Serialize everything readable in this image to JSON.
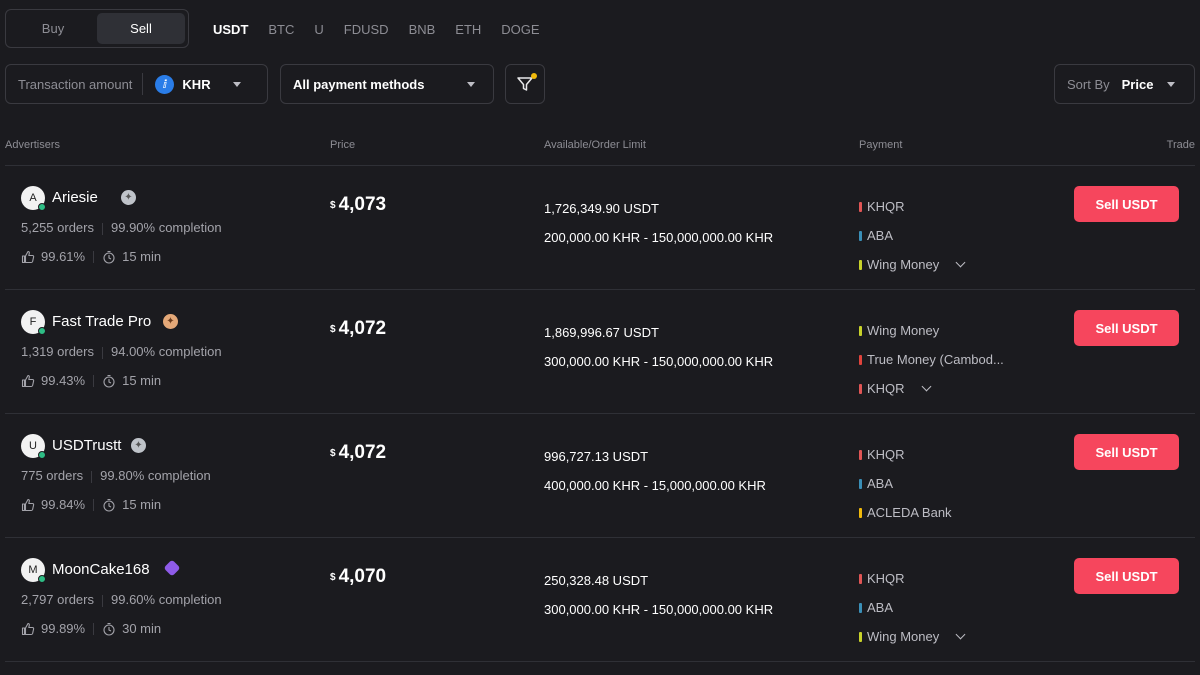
{
  "side_toggle": {
    "buy": "Buy",
    "sell": "Sell",
    "active": "Sell"
  },
  "assets": [
    "USDT",
    "BTC",
    "U",
    "FDUSD",
    "BNB",
    "ETH",
    "DOGE"
  ],
  "active_asset": "USDT",
  "filters": {
    "amount_label": "Transaction amount",
    "fiat": "KHR",
    "payment_methods": "All payment methods",
    "sort_label": "Sort By",
    "sort_value": "Price"
  },
  "columns": {
    "advertisers": "Advertisers",
    "price": "Price",
    "available": "Available/Order Limit",
    "payment": "Payment",
    "trade": "Trade"
  },
  "currency_symbol": "$",
  "colors": {
    "sell_button": "#f6465d",
    "KHQR": "#e05555",
    "ABA": "#3a8fb7",
    "Wing Money": "#c8d22a",
    "True Money (Cambod...": "#e0433c",
    "ACLEDA Bank": "#f0b90b"
  },
  "ads": [
    {
      "initial": "A",
      "name": "Ariesie",
      "badge": "silver",
      "orders": "5,255 orders",
      "completion": "99.90% completion",
      "rating": "99.61%",
      "time": "15 min",
      "price": "4,073",
      "available": "1,726,349.90 USDT",
      "limit": "200,000.00 KHR - 150,000,000.00 KHR",
      "payments": [
        "KHQR",
        "ABA",
        "Wing Money"
      ],
      "more": true,
      "button": "Sell USDT"
    },
    {
      "initial": "F",
      "name": "Fast Trade Pro",
      "badge": "bronze",
      "orders": "1,319 orders",
      "completion": "94.00% completion",
      "rating": "99.43%",
      "time": "15 min",
      "price": "4,072",
      "available": "1,869,996.67 USDT",
      "limit": "300,000.00 KHR - 150,000,000.00 KHR",
      "payments": [
        "Wing Money",
        "True Money (Cambod...",
        "KHQR"
      ],
      "more": true,
      "button": "Sell USDT"
    },
    {
      "initial": "U",
      "name": "USDTrustt",
      "badge": "silver",
      "orders": "775 orders",
      "completion": "99.80% completion",
      "rating": "99.84%",
      "time": "15 min",
      "price": "4,072",
      "available": "996,727.13 USDT",
      "limit": "400,000.00 KHR - 15,000,000.00 KHR",
      "payments": [
        "KHQR",
        "ABA",
        "ACLEDA Bank"
      ],
      "more": false,
      "button": "Sell USDT"
    },
    {
      "initial": "M",
      "name": "MoonCake168",
      "badge": "purple",
      "orders": "2,797 orders",
      "completion": "99.60% completion",
      "rating": "99.89%",
      "time": "30 min",
      "price": "4,070",
      "available": "250,328.48 USDT",
      "limit": "300,000.00 KHR - 150,000,000.00 KHR",
      "payments": [
        "KHQR",
        "ABA",
        "Wing Money"
      ],
      "more": true,
      "button": "Sell USDT"
    }
  ]
}
